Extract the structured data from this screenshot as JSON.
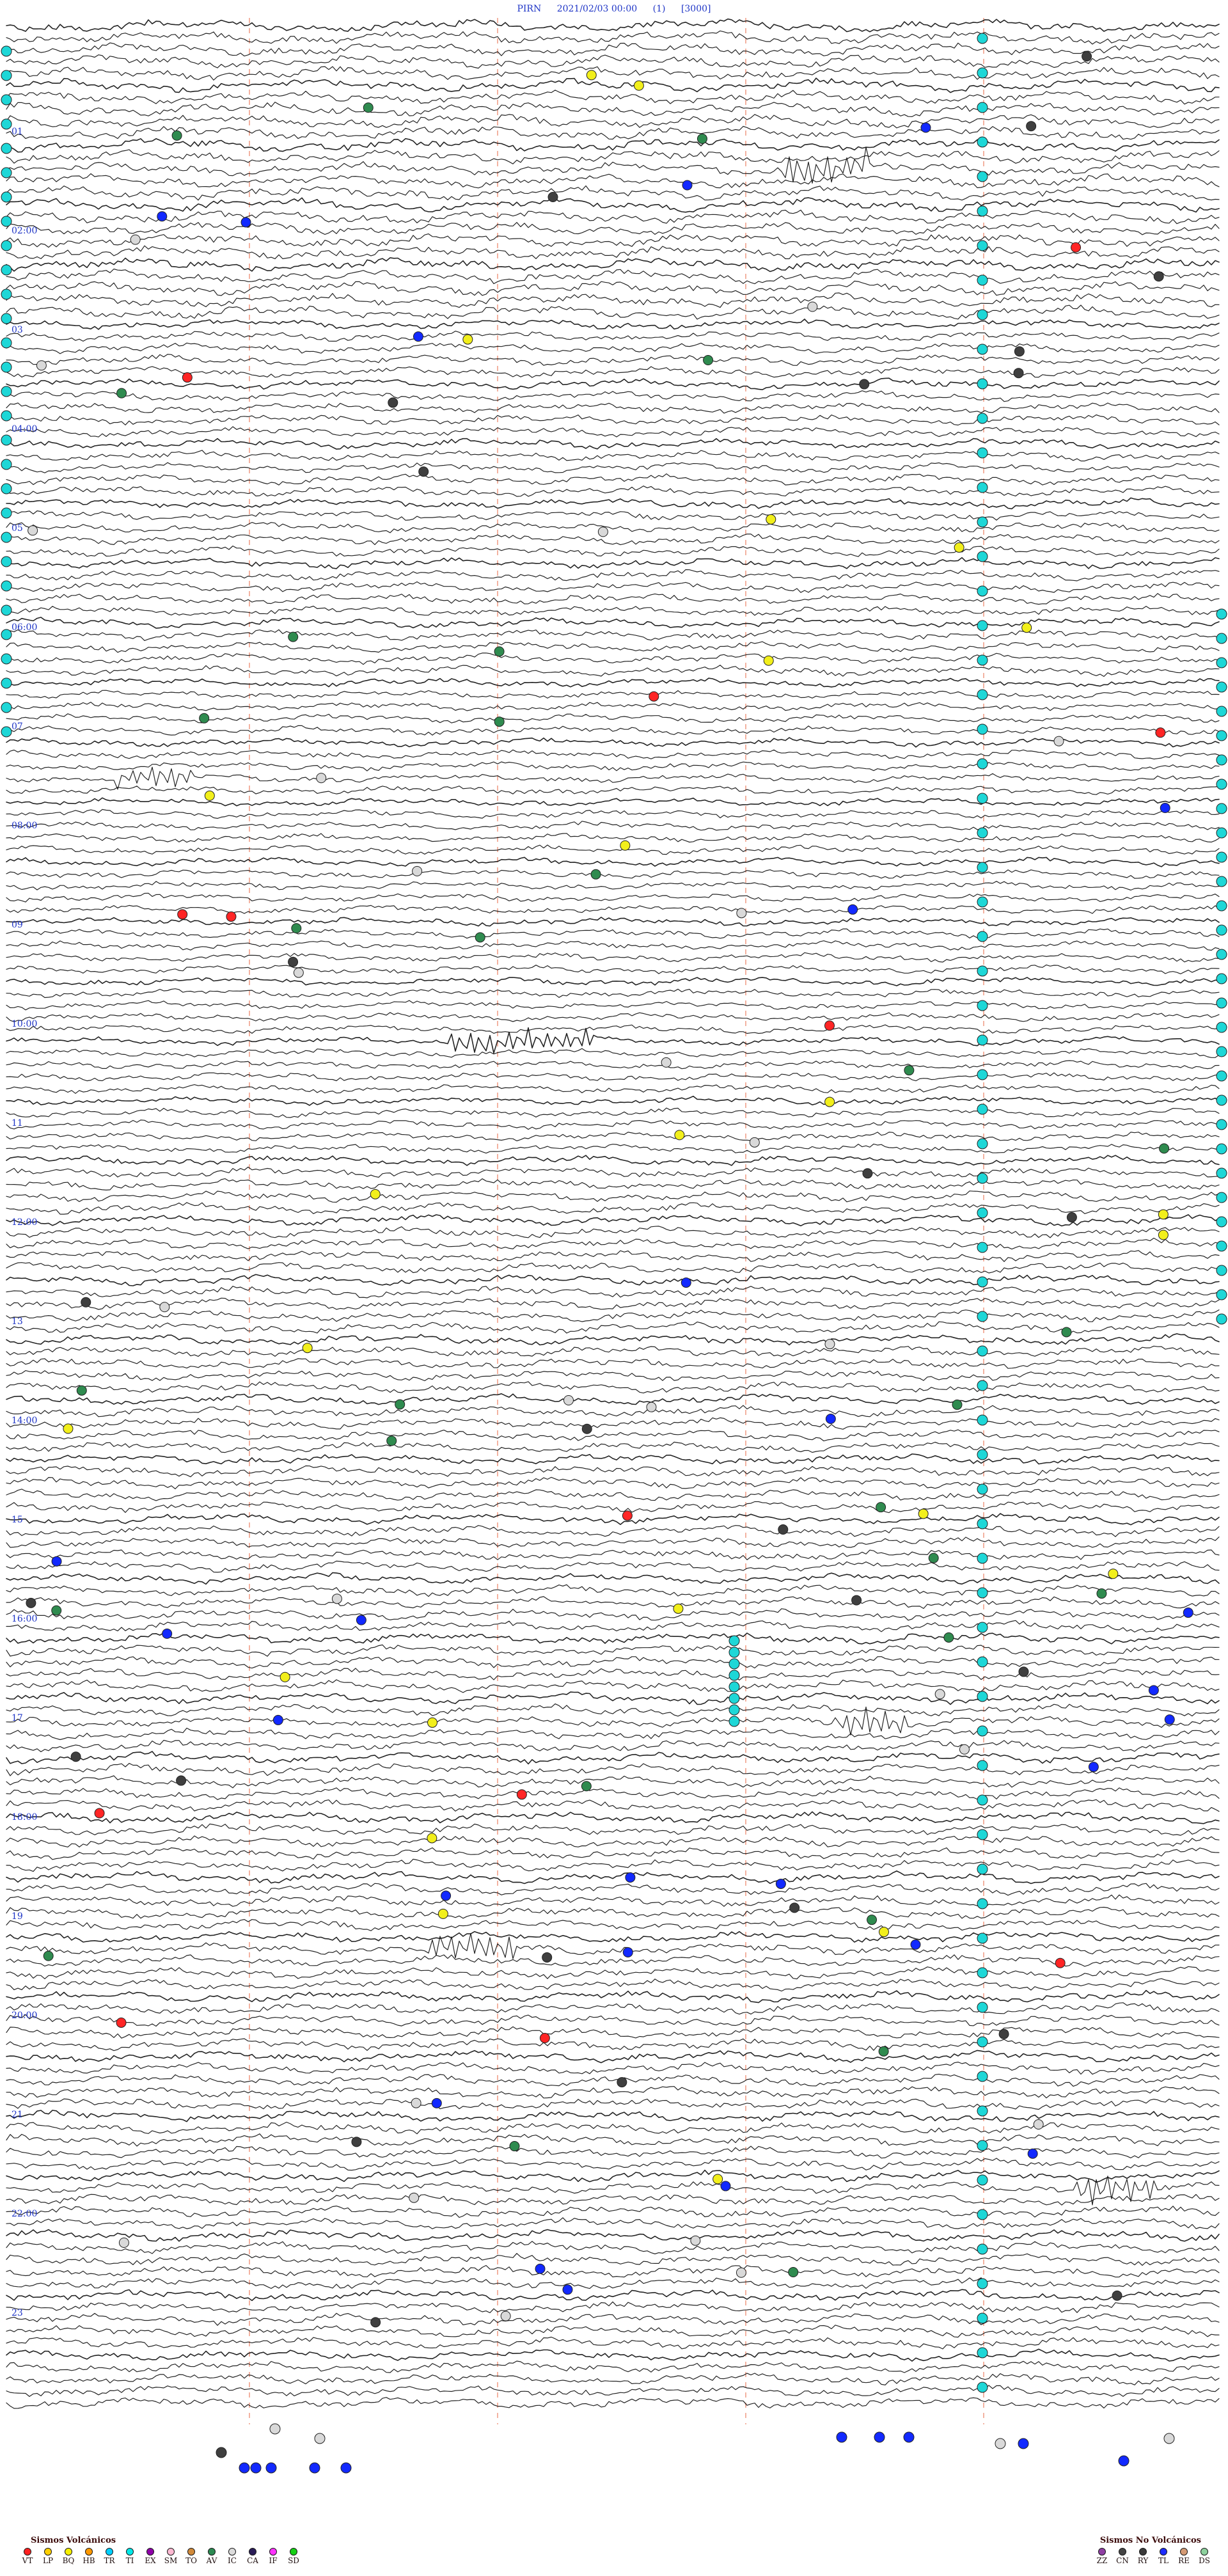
{
  "header": {
    "station": "PIRN",
    "datetime": "2021/02/03 00:00",
    "channel": "(1)",
    "scale": "[3000]"
  },
  "left_labels": [
    "01",
    "02:00",
    "03",
    "04:00",
    "05",
    "06:00",
    "07",
    "08:00",
    "09",
    "10:00",
    "11",
    "12:00",
    "13",
    "14:00",
    "15",
    "16:00",
    "17",
    "18:00",
    "19",
    "20:00",
    "21",
    "22:00",
    "23"
  ],
  "legend_left": {
    "title": "Sismos Volcánicos",
    "items": [
      {
        "code": "VT",
        "color": "#ff2020"
      },
      {
        "code": "LP",
        "color": "#ffd000"
      },
      {
        "code": "BQ",
        "color": "#f7f000"
      },
      {
        "code": "HB",
        "color": "#ff9900"
      },
      {
        "code": "TR",
        "color": "#00cfff"
      },
      {
        "code": "TI",
        "color": "#00e8e8"
      },
      {
        "code": "EX",
        "color": "#8e00a8"
      },
      {
        "code": "SM",
        "color": "#ffb9d2"
      },
      {
        "code": "TO",
        "color": "#d18a3b"
      },
      {
        "code": "AV",
        "color": "#2c8a52"
      },
      {
        "code": "IC",
        "color": "#dcdcdc"
      },
      {
        "code": "CA",
        "color": "#2a1c57"
      },
      {
        "code": "IF",
        "color": "#ff33ff"
      },
      {
        "code": "SD",
        "color": "#16d116"
      }
    ]
  },
  "legend_right": {
    "title": "Sismos No Volcánicos",
    "items": [
      {
        "code": "ZZ",
        "color": "#8f3fa3"
      },
      {
        "code": "CN",
        "color": "#454545"
      },
      {
        "code": "RY",
        "color": "#3a3a3a"
      },
      {
        "code": "TL",
        "color": "#1d2cff"
      },
      {
        "code": "RE",
        "color": "#d49a74"
      },
      {
        "code": "DS",
        "color": "#8ed19e"
      }
    ]
  },
  "colors": {
    "trace": "#111111",
    "grid": "#f3b3a1",
    "label": "#1f35c6",
    "cyan": "#1ed7d7",
    "red": "#ff2525",
    "yellow": "#f2ef1b",
    "blue": "#1229ff",
    "gray": "#d9d9d9",
    "dark": "#3f3f3f",
    "green": "#2f8b4f"
  }
}
